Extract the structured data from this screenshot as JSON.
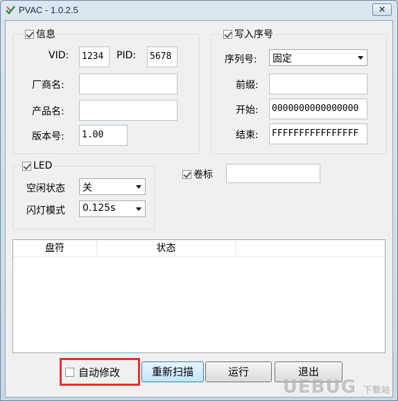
{
  "window": {
    "title": "PVAC - 1.0.2.5",
    "close_glyph": "✕"
  },
  "info_group": {
    "label": "信息",
    "checked": true,
    "vid_label": "VID:",
    "vid_value": "1234",
    "pid_label": "PID:",
    "pid_value": "5678",
    "vendor_label": "厂商名:",
    "vendor_value": "",
    "product_label": "产品名:",
    "product_value": "",
    "version_label": "版本号:",
    "version_value": "1.00"
  },
  "serial_group": {
    "label": "写入序号",
    "checked": true,
    "serial_label": "序列号:",
    "serial_mode": "固定",
    "prefix_label": "前缀:",
    "prefix_value": "",
    "start_label": "开始:",
    "start_value": "0000000000000000",
    "end_label": "结束:",
    "end_value": "FFFFFFFFFFFFFFFF"
  },
  "led_group": {
    "label": "LED",
    "checked": true,
    "idle_label": "空闲状态",
    "idle_value": "关",
    "blink_label": "闪灯模式",
    "blink_value": "0.125s"
  },
  "volume": {
    "label": "卷标",
    "checked": true,
    "value": ""
  },
  "list": {
    "columns": [
      "盘符",
      "状态"
    ],
    "rows": []
  },
  "footer": {
    "auto_modify_label": "自动修改",
    "auto_modify_checked": false,
    "rescan_label": "重新扫描",
    "run_label": "运行",
    "exit_label": "退出"
  },
  "watermark": {
    "text": "UEBUG",
    "suffix": "下载站"
  },
  "colors": {
    "highlight_border": "#e03030",
    "focused_button": "#bee6fd"
  }
}
